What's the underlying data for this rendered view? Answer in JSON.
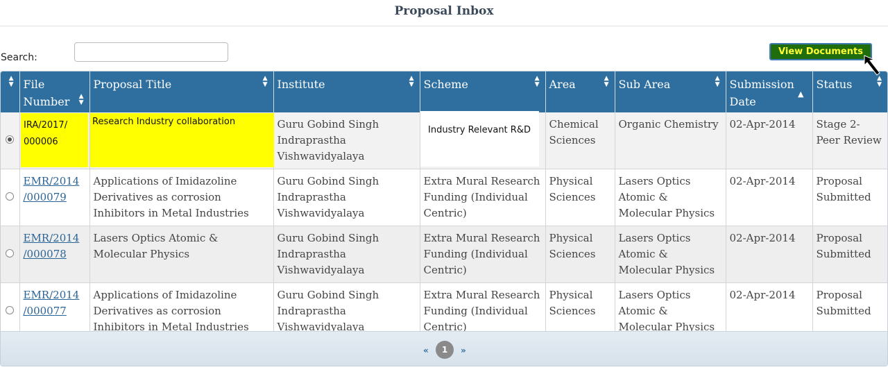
{
  "page": {
    "title": "Proposal Inbox"
  },
  "search": {
    "label": "Search:",
    "value": ""
  },
  "toolbar": {
    "view_documents_label": "View Documents"
  },
  "table": {
    "columns": [
      {
        "label": "",
        "sort": "both"
      },
      {
        "label": "File Number",
        "sort": "both"
      },
      {
        "label": "Proposal Title",
        "sort": "both"
      },
      {
        "label": "Institute",
        "sort": "both"
      },
      {
        "label": "Scheme",
        "sort": "both"
      },
      {
        "label": "Area",
        "sort": "both"
      },
      {
        "label": "Sub Area",
        "sort": "both"
      },
      {
        "label": "Submission Date",
        "sort": "ascending"
      },
      {
        "label": "Status",
        "sort": "both"
      }
    ],
    "rows": [
      {
        "selected": true,
        "file_number": "IRA/2017/000006",
        "file_number_display_1": "IRA/2017/",
        "file_number_display_2": "000006",
        "proposal_title": "Research Industry collaboration",
        "institute": "Guru Gobind Singh Indraprastha Vishwavidyalaya",
        "scheme": "Industry Relevant R&D",
        "area": "Chemical Sciences",
        "sub_area": "Organic Chemistry",
        "submission_date": "02-Apr-2014",
        "status": "Stage 2- Peer Review"
      },
      {
        "selected": false,
        "file_number_display_1": "EMR/2014",
        "file_number_display_2": "/000079",
        "proposal_title": "Applications of Imidazoline Derivatives as corrosion Inhibitors in Metal Industries",
        "institute": "Guru Gobind Singh Indraprastha Vishwavidyalaya",
        "scheme": "Extra Mural Research Funding (Individual Centric)",
        "area": "Physical Sciences",
        "sub_area": "Lasers Optics Atomic & Molecular Physics",
        "submission_date": "02-Apr-2014",
        "status": "Proposal Submitted"
      },
      {
        "selected": false,
        "file_number_display_1": "EMR/2014",
        "file_number_display_2": "/000078",
        "proposal_title": "Lasers Optics Atomic & Molecular Physics",
        "institute": "Guru Gobind Singh Indraprastha Vishwavidyalaya",
        "scheme": "Extra Mural Research Funding (Individual Centric)",
        "area": "Physical Sciences",
        "sub_area": "Lasers Optics Atomic & Molecular Physics",
        "submission_date": "02-Apr-2014",
        "status": "Proposal Submitted"
      },
      {
        "selected": false,
        "file_number_display_1": "EMR/2014",
        "file_number_display_2": "/000077",
        "proposal_title": "Applications of Imidazoline Derivatives as corrosion Inhibitors in Metal Industries",
        "institute": "Guru Gobind Singh Indraprastha Vishwavidyalaya",
        "scheme": "Extra Mural Research Funding (Individual Centric)",
        "area": "Physical Sciences",
        "sub_area": "Lasers Optics Atomic & Molecular Physics",
        "submission_date": "02-Apr-2014",
        "status": "Proposal Submitted"
      }
    ]
  },
  "pager": {
    "prev": "«",
    "current": "1",
    "next": "»"
  },
  "icons": {
    "sort": "sort-both-icon",
    "sort_asc": "sort-ascending-icon",
    "cursor": "mouse-cursor-icon",
    "radio": "radio-icon"
  },
  "colors": {
    "header_bg": "#2f6f9f",
    "highlight": "#ffff00",
    "button_bg": "#1f6d0c",
    "button_text": "#ffff33",
    "link": "#2a6496"
  }
}
